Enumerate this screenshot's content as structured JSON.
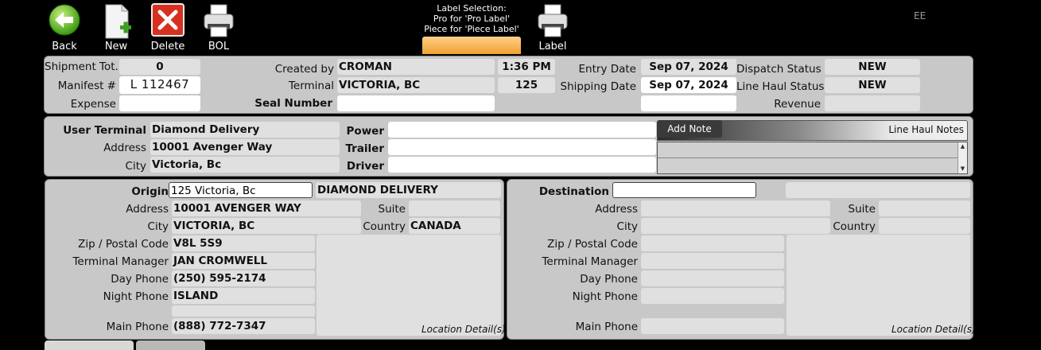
{
  "toolbar": {
    "back": "Back",
    "new": "New",
    "delete": "Delete",
    "bol": "BOL",
    "label": "Label",
    "label_selection": [
      "Label Selection:",
      "Pro for 'Pro Label'",
      "Piece for 'Piece Label'"
    ],
    "user_initials": "EE"
  },
  "header": {
    "shipment_tot_label": "Shipment Tot.",
    "shipment_tot": "0",
    "manifest_label": "Manifest #",
    "manifest": "L 112467",
    "expense_label": "Expense",
    "expense": "",
    "created_by_label": "Created by",
    "created_by": "CROMAN",
    "created_time": "1:36 PM",
    "terminal_label": "Terminal",
    "terminal": "VICTORIA, BC",
    "terminal_no": "125",
    "seal_label": "Seal Number",
    "seal": "",
    "entry_date_label": "Entry Date",
    "entry_date": "Sep 07, 2024",
    "shipping_date_label": "Shipping Date",
    "shipping_date": "Sep 07, 2024",
    "dispatch_status_label": "Dispatch Status",
    "dispatch_status": "NEW",
    "line_haul_status_label": "Line Haul Status",
    "line_haul_status": "NEW",
    "revenue_label": "Revenue",
    "revenue": ""
  },
  "user": {
    "terminal_label": "User Terminal",
    "terminal": "Diamond Delivery",
    "address_label": "Address",
    "address": "10001 Avenger Way",
    "city_label": "City",
    "city": "Victoria, Bc",
    "power_label": "Power",
    "trailer_label": "Trailer",
    "driver_label": "Driver",
    "add_note": "Add Note",
    "notes_title": "Line Haul Notes"
  },
  "origin": {
    "label": "Origin",
    "value": "125 Victoria, Bc",
    "company": "DIAMOND DELIVERY",
    "address_label": "Address",
    "address": "10001 AVENGER WAY",
    "suite_label": "Suite",
    "suite": "",
    "city_label": "City",
    "city": "VICTORIA, BC",
    "country_label": "Country",
    "country": "CANADA",
    "zip_label": "Zip / Postal Code",
    "zip": "V8L 5S9",
    "manager_label": "Terminal Manager",
    "manager": "JAN CROMWELL",
    "day_phone_label": "Day Phone",
    "day_phone": "(250) 595-2174",
    "night_phone_label": "Night Phone",
    "night_phone": "ISLAND",
    "main_phone_label": "Main Phone",
    "main_phone": "(888) 772-7347",
    "location_detail": "Location Detail(s)"
  },
  "destination": {
    "label": "Destination",
    "value": "",
    "address_label": "Address",
    "suite_label": "Suite",
    "city_label": "City",
    "country_label": "Country",
    "zip_label": "Zip / Postal Code",
    "manager_label": "Terminal Manager",
    "day_phone_label": "Day Phone",
    "night_phone_label": "Night Phone",
    "main_phone_label": "Main Phone",
    "location_detail": "Location Detail(s)"
  }
}
